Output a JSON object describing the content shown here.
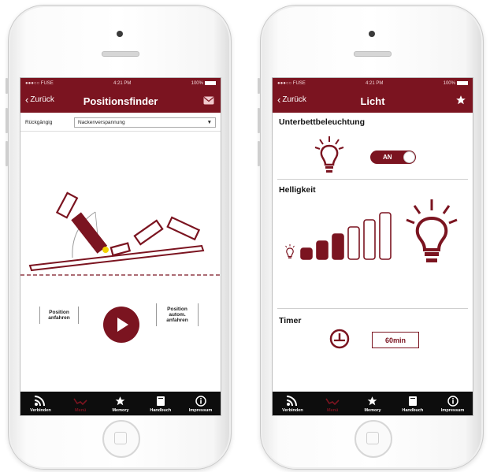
{
  "colors": {
    "accent": "#7b1420",
    "tabbar": "#0d0d0d",
    "background": "#ffffff"
  },
  "status": {
    "carrier": "●●●○○ FUSE",
    "time": "4:21 PM",
    "battery": "100%"
  },
  "left": {
    "back_label": "Zurück",
    "title": "Positionsfinder",
    "right_icon": "mail-icon",
    "dropdown_label": "Rückgängig",
    "dropdown_value": "Nackenverspannung",
    "btn_position_go": "Position anfahren",
    "btn_position_auto": "Position autom. anfahren",
    "play_icon": "play-icon"
  },
  "right": {
    "back_label": "Zurück",
    "title": "Licht",
    "right_icon": "star-icon",
    "section_underbed": "Unterbettbeleuchtung",
    "toggle_label": "AN",
    "section_brightness": "Helligkeit",
    "brightness_levels": 6,
    "brightness_selected": 3,
    "section_timer": "Timer",
    "timer_value": "60min"
  },
  "tabs": [
    {
      "label": "Verbinden",
      "icon": "rss-icon",
      "active": false
    },
    {
      "label": "Menü",
      "icon": "bed-icon",
      "active": true
    },
    {
      "label": "Memory",
      "icon": "star-icon",
      "active": false
    },
    {
      "label": "Handbuch",
      "icon": "book-icon",
      "active": false
    },
    {
      "label": "Impressum",
      "icon": "info-icon",
      "active": false
    }
  ]
}
